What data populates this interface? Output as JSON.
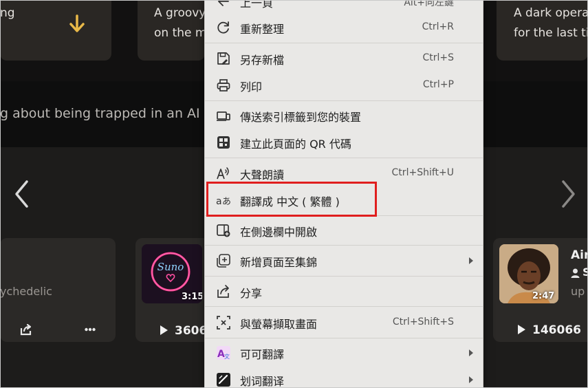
{
  "top_cards": {
    "left_text": "ng",
    "middle_text_line1": "A groovy",
    "middle_text_line2": "on the m",
    "right_text_line1": "A dark opera",
    "right_text_line2": "for the last ti"
  },
  "prompt_text": "g about being trapped in an AI",
  "songs": [
    {
      "genre_text": "ychedelic"
    },
    {
      "duration": "3:15",
      "plays": "3606",
      "logo_text": "Suno"
    },
    {
      "duration": "2:47",
      "plays": "146066",
      "title": "Air",
      "artist_text": "S",
      "sub_text": "up"
    }
  ],
  "context_menu": {
    "items": [
      {
        "label": "上一頁",
        "shortcut": "Alt+向左鍵"
      },
      {
        "label": "重新整理",
        "shortcut": "Ctrl+R"
      },
      {
        "label": "另存新檔",
        "shortcut": "Ctrl+S"
      },
      {
        "label": "列印",
        "shortcut": "Ctrl+P"
      },
      {
        "label": "傳送索引標籤到您的裝置",
        "shortcut": ""
      },
      {
        "label": "建立此頁面的 QR 代碼",
        "shortcut": ""
      },
      {
        "label": "大聲朗讀",
        "shortcut": "Ctrl+Shift+U"
      },
      {
        "label": "翻譯成 中文 ( 繁體 )",
        "shortcut": ""
      },
      {
        "label": "在側邊欄中開啟",
        "shortcut": ""
      },
      {
        "label": "新增頁面至集錦",
        "shortcut": ""
      },
      {
        "label": "分享",
        "shortcut": ""
      },
      {
        "label": "與螢幕擷取畫面",
        "shortcut": "Ctrl+Shift+S"
      },
      {
        "label": "可可翻譯",
        "shortcut": ""
      },
      {
        "label": "划词翻译",
        "shortcut": ""
      }
    ]
  },
  "colors": {
    "highlight": "#e01e1e",
    "menu_bg": "#e9e8e6",
    "accent_yellow": "#e9b948",
    "page_bg": "#151313"
  }
}
